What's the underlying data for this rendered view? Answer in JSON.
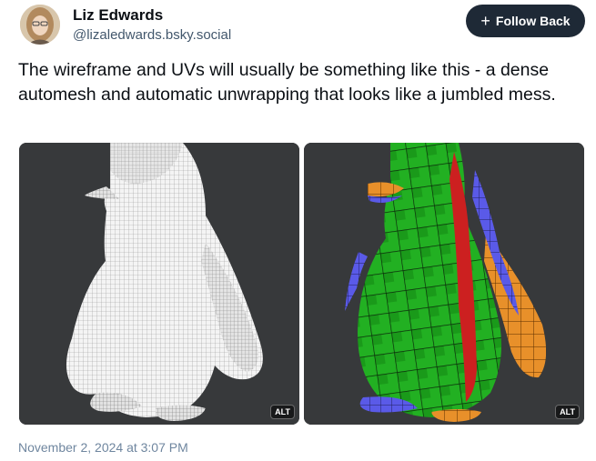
{
  "post": {
    "author_name": "Liz Edwards",
    "author_handle": "@lizaledwards.bsky.social",
    "follow_label": "Follow Back",
    "text": "The wireframe and UVs will usually be something like this - a dense automesh and automatic unwrapping that looks like a jumbled mess.",
    "timestamp": "November 2, 2024 at 3:07 PM"
  },
  "images": [
    {
      "alt_badge": "ALT",
      "content": "wireframe-penguin-render"
    },
    {
      "alt_badge": "ALT",
      "content": "uv-checker-penguin-render"
    }
  ],
  "colors": {
    "follow_button_bg": "#1e2936",
    "image_bg": "#37393b",
    "handle_text": "#42576c",
    "timestamp_text": "#6f869f"
  }
}
